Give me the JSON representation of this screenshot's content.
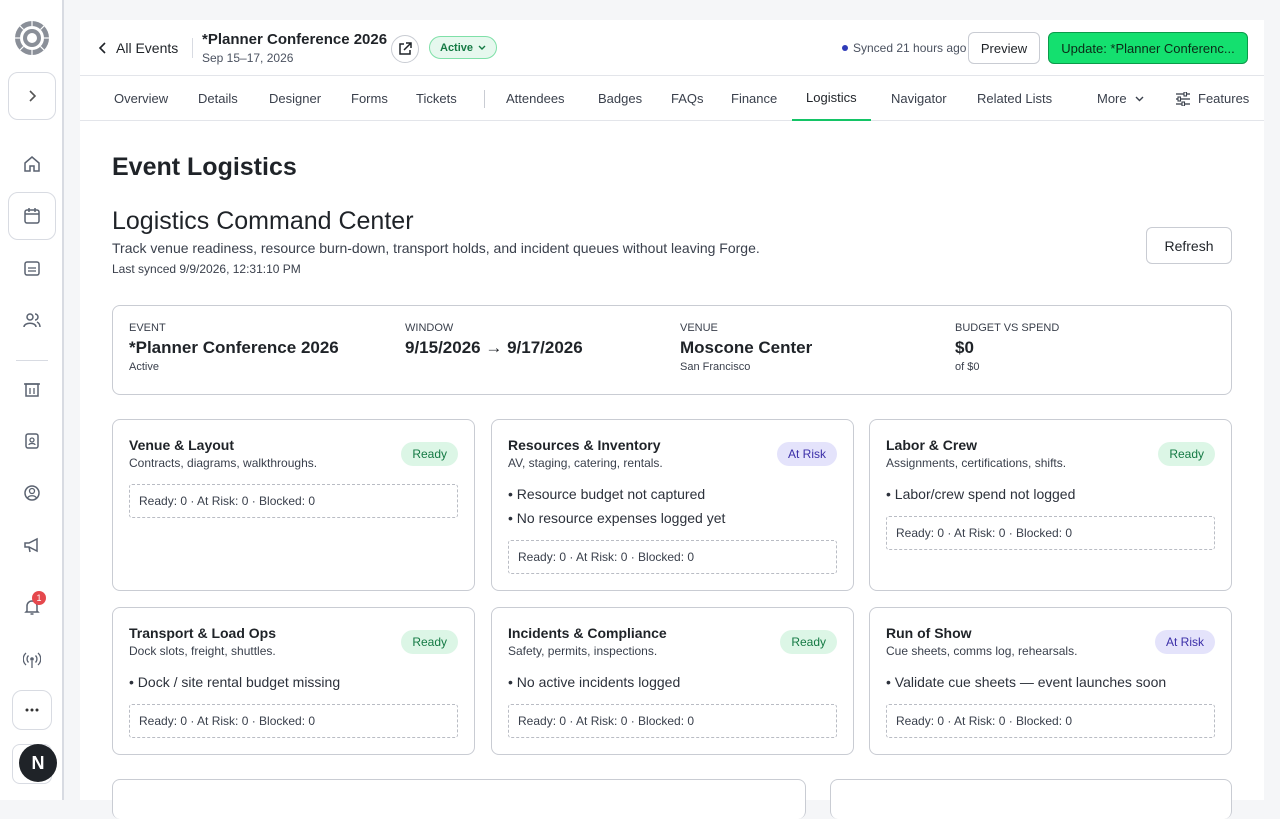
{
  "header": {
    "back_label": "All Events",
    "event_title": "*Planner Conference 2026",
    "event_dates": "Sep 15–17, 2026",
    "status": "Active",
    "synced": "Synced 21 hours ago",
    "preview_label": "Preview",
    "update_label": "Update: *Planner Conferenc..."
  },
  "tabs": [
    {
      "label": "Overview"
    },
    {
      "label": "Details"
    },
    {
      "label": "Designer"
    },
    {
      "label": "Forms"
    },
    {
      "label": "Tickets"
    },
    {
      "label": "Attendees"
    },
    {
      "label": "Badges"
    },
    {
      "label": "FAQs"
    },
    {
      "label": "Finance"
    },
    {
      "label": "Logistics"
    },
    {
      "label": "Navigator"
    },
    {
      "label": "Related Lists"
    },
    {
      "label": "More"
    }
  ],
  "features_label": "Features",
  "rail": {
    "notification_count": "1",
    "avatar_initial": "N"
  },
  "page": {
    "heading": "Event Logistics",
    "section_title": "Logistics Command Center",
    "section_sub": "Track venue readiness, resource burn-down, transport holds, and incident queues without leaving Forge.",
    "last_synced": "Last synced 9/9/2026, 12:31:10 PM",
    "refresh_label": "Refresh"
  },
  "summary": [
    {
      "label": "Event",
      "value": "*Planner Conference 2026",
      "note": "Active"
    },
    {
      "label": "Window",
      "value": "9/15/2026 → 9/17/2026",
      "note": ""
    },
    {
      "label": "Venue",
      "value": "Moscone Center",
      "note": "San Francisco"
    },
    {
      "label": "Budget vs spend",
      "value": "$0",
      "note": "of $0"
    }
  ],
  "cards": [
    {
      "title": "Venue & Layout",
      "desc": "Contracts, diagrams, walkthroughs.",
      "status": "Ready",
      "items": [],
      "counts": "Ready: 0 · At Risk: 0 · Blocked: 0"
    },
    {
      "title": "Resources & Inventory",
      "desc": "AV, staging, catering, rentals.",
      "status": "At Risk",
      "items": [
        "Resource budget not captured",
        "No resource expenses logged yet"
      ],
      "counts": "Ready: 0 · At Risk: 0 · Blocked: 0"
    },
    {
      "title": "Labor & Crew",
      "desc": "Assignments, certifications, shifts.",
      "status": "Ready",
      "items": [
        "Labor/crew spend not logged"
      ],
      "counts": "Ready: 0 · At Risk: 0 · Blocked: 0"
    },
    {
      "title": "Transport & Load Ops",
      "desc": "Dock slots, freight, shuttles.",
      "status": "Ready",
      "items": [
        "Dock / site rental budget missing"
      ],
      "counts": "Ready: 0 · At Risk: 0 · Blocked: 0"
    },
    {
      "title": "Incidents & Compliance",
      "desc": "Safety, permits, inspections.",
      "status": "Ready",
      "items": [
        "No active incidents logged"
      ],
      "counts": "Ready: 0 · At Risk: 0 · Blocked: 0"
    },
    {
      "title": "Run of Show",
      "desc": "Cue sheets, comms log, rehearsals.",
      "status": "At Risk",
      "items": [
        "Validate cue sheets — event launches soon"
      ],
      "counts": "Ready: 0 · At Risk: 0 · Blocked: 0"
    }
  ]
}
